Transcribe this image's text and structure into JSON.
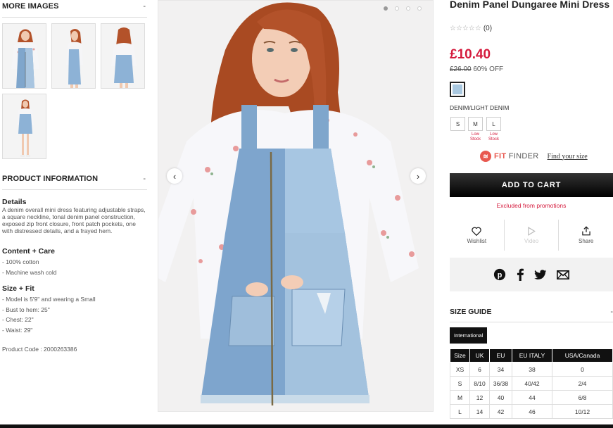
{
  "left": {
    "more_images": {
      "title": "MORE IMAGES",
      "toggle": "-"
    },
    "product_info": {
      "title": "PRODUCT INFORMATION",
      "toggle": "-",
      "details_heading": "Details",
      "details_text": "A denim overall mini dress featuring adjustable straps, a square neckline, tonal denim panel construction, exposed zip front closure, front patch pockets, one with distressed details, and a frayed hem.",
      "content_heading": "Content + Care",
      "content_items": [
        "- 100% cotton",
        "- Machine wash cold"
      ],
      "fit_heading": "Size + Fit",
      "fit_items": [
        "- Model is 5'9\" and wearing a Small",
        "- Bust to hem: 25\"",
        "- Chest: 22\"",
        "- Waist: 29\""
      ],
      "product_code": "Product Code : 2000263386"
    }
  },
  "carousel": {
    "prev": "‹",
    "next": "›"
  },
  "product": {
    "title": "Denim Panel Dungaree Mini Dress",
    "stars": "☆☆☆☆☆",
    "review_count": "(0)",
    "price": "£10.40",
    "original_price": "£26.00",
    "discount": "60% OFF",
    "swatch_color": "#a9c8e0",
    "color_name": "DENIM/LIGHT DENIM",
    "sizes": [
      "S",
      "M",
      "L"
    ],
    "low_stock": [
      "Low",
      "Stock"
    ],
    "fit_finder": {
      "brand_bold": "FIT",
      "brand_rest": " FINDER",
      "link": "Find your size"
    },
    "add_to_cart": "ADD TO CART",
    "excluded": "Excluded from promotions",
    "actions": {
      "wishlist": "Wishlist",
      "video": "Video",
      "share": "Share"
    }
  },
  "size_guide": {
    "title": "SIZE GUIDE",
    "toggle": "-",
    "tab": "International",
    "headers": [
      "Size",
      "UK",
      "EU",
      "EU ITALY",
      "USA/Canada"
    ],
    "rows": [
      [
        "XS",
        "6",
        "34",
        "38",
        "0"
      ],
      [
        "S",
        "8/10",
        "36/38",
        "40/42",
        "2/4"
      ],
      [
        "M",
        "12",
        "40",
        "44",
        "6/8"
      ],
      [
        "L",
        "14",
        "42",
        "46",
        "10/12"
      ]
    ]
  }
}
